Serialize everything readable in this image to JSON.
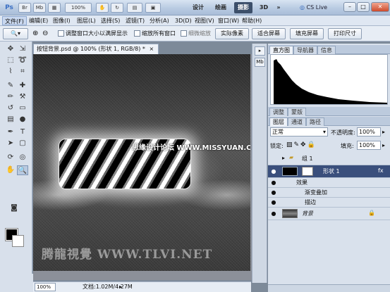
{
  "titlebar": {
    "logo": "Ps",
    "icon_labels": [
      "Br",
      "Mb",
      "",
      "100%",
      ""
    ],
    "ws_design": "设计",
    "ws_paint": "绘画",
    "ws_photo": "摄影",
    "ws_3d": "3D",
    "ws_more": "»",
    "cslive": "CS Live",
    "min": "–",
    "restore": "□",
    "close": "✕"
  },
  "menu": [
    "文件(F)",
    "编辑(E)",
    "图像(I)",
    "图层(L)",
    "选择(S)",
    "滤镜(T)",
    "分析(A)",
    "3D(D)",
    "视图(V)",
    "窗口(W)",
    "帮助(H)"
  ],
  "options": {
    "resize_windows": "调整窗口大小以满屏显示",
    "zoom_all": "缩放所有窗口",
    "scrubby": "细微缩放",
    "actual_pixels": "实际像素",
    "fit_screen": "适合屏幕",
    "fill_screen": "填充屏幕",
    "print_size": "打印尺寸"
  },
  "document": {
    "tab_title": "按钮背景.psd @ 100% (形状 1, RGB/8) *",
    "tab_close": "×",
    "watermark_url": "思缘设计论坛  WWW.MISSYUAN.COM",
    "watermark_logo": "腾龍視覺 WWW.TLVI.NET",
    "zoom": "100%",
    "doc_info": "文档:1.02M/4.27M"
  },
  "panels": {
    "histogram_tabs": [
      "直方图",
      "导航器",
      "信息"
    ],
    "adjust_tabs": [
      "调整",
      "蒙版"
    ],
    "layers_tabs": [
      "图层",
      "通道",
      "路径"
    ],
    "blend_mode": "正常",
    "opacity_label": "不透明度:",
    "opacity": "100%",
    "lock_label": "锁定:",
    "fill_label": "填充:",
    "fill": "100%",
    "layers": [
      {
        "name": "组 1",
        "kind": "group"
      },
      {
        "name": "形状 1",
        "kind": "shape",
        "selected": true
      },
      {
        "name": "效果",
        "kind": "effects"
      },
      {
        "name": "渐变叠加",
        "kind": "effect"
      },
      {
        "name": "描边",
        "kind": "effect"
      },
      {
        "name": "背景",
        "kind": "background"
      }
    ]
  },
  "colors": {
    "foreground": "#000000",
    "background": "#ffffff",
    "selected_layer": "#3a4f7c"
  }
}
